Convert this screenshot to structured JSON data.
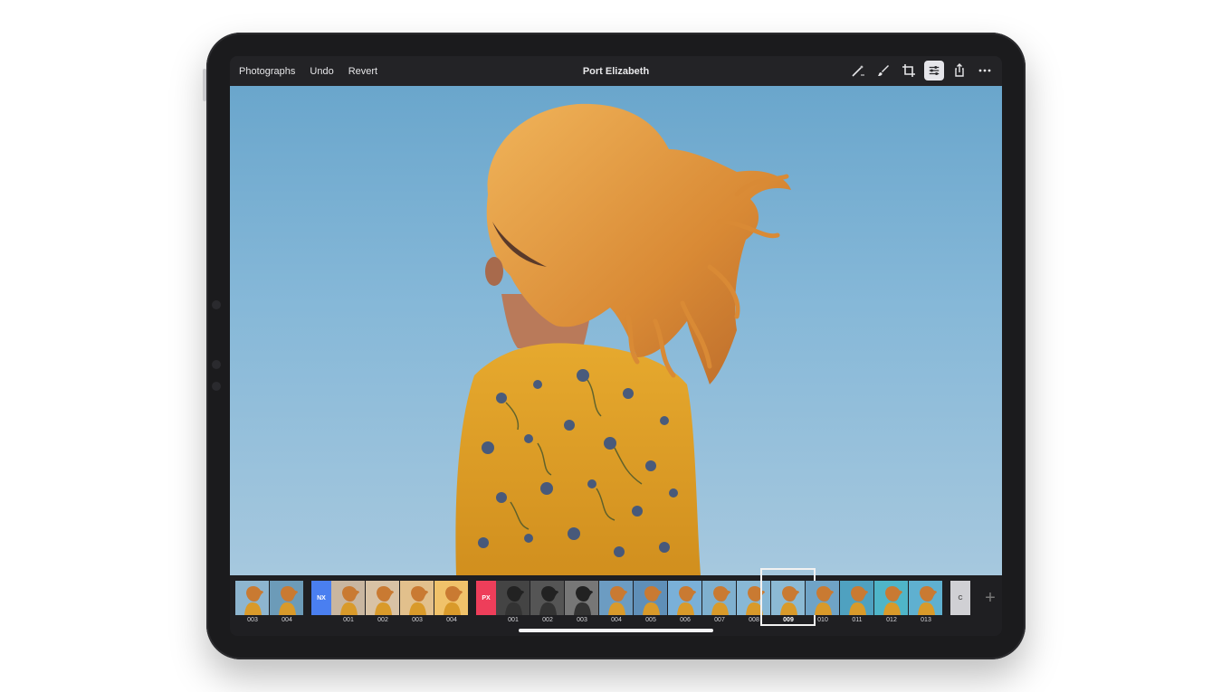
{
  "toolbar": {
    "left_items": [
      "Photographs",
      "Undo",
      "Revert"
    ],
    "title": "Port Elizabeth",
    "icons": [
      "magic-wand-icon",
      "brush-icon",
      "crop-icon",
      "adjustments-icon",
      "share-icon",
      "more-icon"
    ],
    "active_icon": "adjustments-icon"
  },
  "filmstrip": {
    "groups": [
      {
        "tag": "",
        "tag_color": "",
        "labels": [
          "003",
          "004"
        ]
      },
      {
        "tag": "NX",
        "tag_color": "#4a7ff0",
        "labels": [
          "001",
          "002",
          "003",
          "004"
        ]
      },
      {
        "tag": "PX",
        "tag_color": "#ee3e5a",
        "labels": [
          "001",
          "002",
          "003",
          "004",
          "005",
          "006",
          "007",
          "008",
          "009",
          "010",
          "011",
          "012",
          "013"
        ]
      },
      {
        "tag": "C",
        "tag_color": "#d0d0d4",
        "labels": []
      }
    ],
    "selected": "009",
    "add_label": "+"
  },
  "colors": {
    "sky": "#7fb3d5",
    "hair": "#d9893a",
    "dress": "#e0a12c"
  }
}
